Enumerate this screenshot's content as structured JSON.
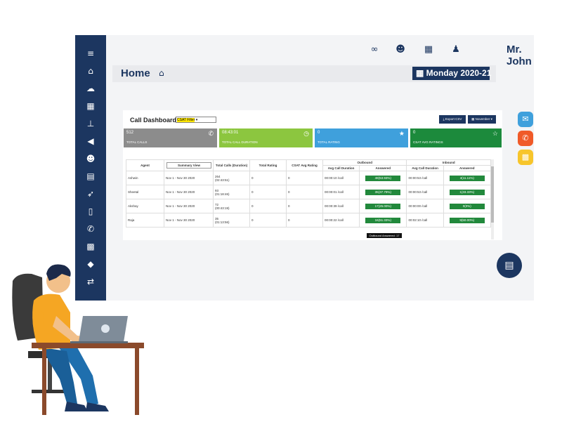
{
  "topbar": {
    "user_name": "Mr. John",
    "icons": [
      "link-icon",
      "users-icon",
      "grid-icon",
      "user-icon"
    ]
  },
  "sidebar": {
    "icons": [
      "menu-icon",
      "home-icon",
      "cloud-icon",
      "calendar-icon",
      "sitemap-icon",
      "megaphone-icon",
      "team-icon",
      "table-icon",
      "rocket-icon",
      "mobile-icon",
      "phone-icon",
      "apps-icon",
      "tag-icon",
      "shuffle-icon"
    ]
  },
  "home": {
    "title": "Home",
    "date": "Monday 2020-21"
  },
  "dashboard": {
    "title": "Call Dashboard",
    "csat_select": "CSAT Filter",
    "export_label": "Export CSV",
    "month_label": "November",
    "tiles": [
      {
        "value": "512",
        "label": "TOTAL CALLS",
        "color": "#8c8c8c"
      },
      {
        "value": "08:43:01",
        "label": "TOTAL CALL DURATION",
        "color": "#8cc63f"
      },
      {
        "value": "0",
        "label": "TOTAL RATING",
        "color": "#3fa0dc"
      },
      {
        "value": "0",
        "label": "CSAT AVG RATINGS",
        "color": "#1c8a3c"
      }
    ],
    "table": {
      "headers": {
        "agent": "Agent",
        "view": "Summary View",
        "total_calls": "Total Calls (Duration)",
        "total_rating": "Total Rating",
        "csat": "CSAT Avg Rating",
        "outbound": "Outbound",
        "inbound": "Inbound",
        "avg_call": "Avg Call Duration",
        "answered": "Answered"
      },
      "rows": [
        {
          "agent": "Ashwin",
          "range": "Nov 1 - Nov 30 2020",
          "calls": "264",
          "duration": "(02:43:51)",
          "rating": "0",
          "csat": "0",
          "out_avg": "00:00:10 /call",
          "out_ans": "48(53.93%)",
          "in_avg": "00:00:53 /call",
          "in_ans": "4(11.11%)"
        },
        {
          "agent": "Sheetal",
          "range": "Nov 1 - Nov 30 2020",
          "calls": "93",
          "duration": "(01:18:46)",
          "rating": "0",
          "csat": "0",
          "out_avg": "00:00:01 /call",
          "out_ans": "35(37.79%)",
          "in_avg": "00:00:53 /call",
          "in_ans": "1(33.33%)"
        },
        {
          "agent": "Akshay",
          "range": "Nov 1 - Nov 30 2020",
          "calls": "72",
          "duration": "(00:43:19)",
          "rating": "0",
          "csat": "0",
          "out_avg": "00:00:39 /call",
          "out_ans": "17(25.00%)",
          "in_avg": "00:00:00 /call",
          "in_ans": "0(0%)"
        },
        {
          "agent": "Raja",
          "range": "Nov 1 - Nov 30 2020",
          "calls": "35",
          "duration": "(01:13:56)",
          "rating": "0",
          "csat": "0",
          "out_avg": "00:00:22 /call",
          "out_ans": "16(51.33%)",
          "in_avg": "00:02:10 /call",
          "in_ans": "9(50.00%)"
        }
      ],
      "tooltip": "Outbound Answered: 17"
    }
  },
  "widgets": {
    "colors": {
      "chat": "#3fa0dc",
      "phone": "#f05a28",
      "apps": "#f7c52b",
      "support": "#1c3660"
    }
  }
}
